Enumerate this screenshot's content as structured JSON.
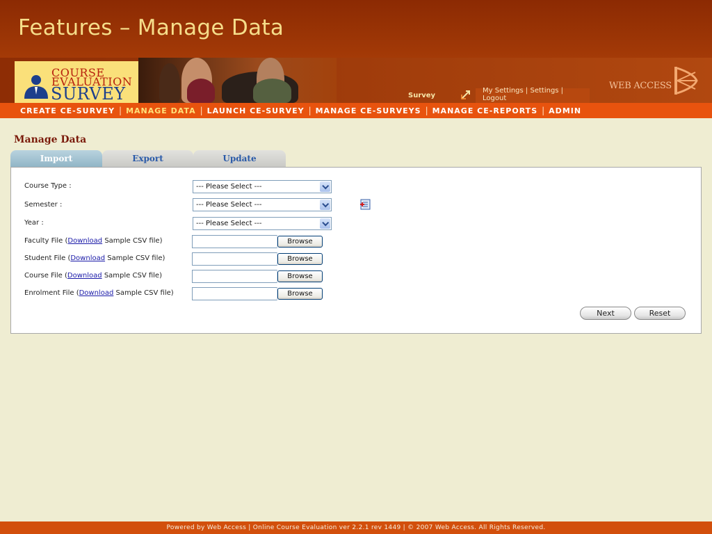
{
  "header": {
    "title": "Features – Manage Data"
  },
  "logo": {
    "line1": "COURSE",
    "line2": "EVALUATION",
    "line3": "SURVEY"
  },
  "banner": {
    "survey_label": "Survey",
    "links": [
      "My Settings",
      "Settings",
      "Logout"
    ],
    "brand": "WEB ACCESS"
  },
  "nav": {
    "items": [
      {
        "label": "CREATE CE-SURVEY",
        "active": false
      },
      {
        "label": "MANAGE DATA",
        "active": true
      },
      {
        "label": "LAUNCH CE-SURVEY",
        "active": false
      },
      {
        "label": "MANAGE CE-SURVEYS",
        "active": false
      },
      {
        "label": "MANAGE CE-REPORTS",
        "active": false
      },
      {
        "label": "ADMIN",
        "active": false
      }
    ]
  },
  "section_title": "Manage Data",
  "tabs": {
    "import": "Import",
    "export": "Export",
    "update": "Update"
  },
  "form": {
    "course_type_label": "Course Type :",
    "semester_label": "Semester :",
    "year_label": "Year :",
    "select_placeholder": "--- Please Select ---",
    "download_link": "Download",
    "sample_suffix": "Sample CSV file)",
    "faculty_prefix": "Faculty File (",
    "student_prefix": "Student File (",
    "course_prefix": "Course File (",
    "enrolment_prefix": "Enrolment File (",
    "browse_label": "Browse",
    "next_label": "Next",
    "reset_label": "Reset"
  },
  "footer": {
    "text": "Powered by Web Access | Online Course Evaluation ver 2.2.1 rev 1449 | © 2007 Web Access. All Rights Reserved."
  },
  "colors": {
    "header_bg": "#9a3405",
    "nav_bg": "#e8530e",
    "page_bg": "#efedd2",
    "active_tab": "#8fb4c5",
    "footer_bg": "#d24f0c"
  }
}
